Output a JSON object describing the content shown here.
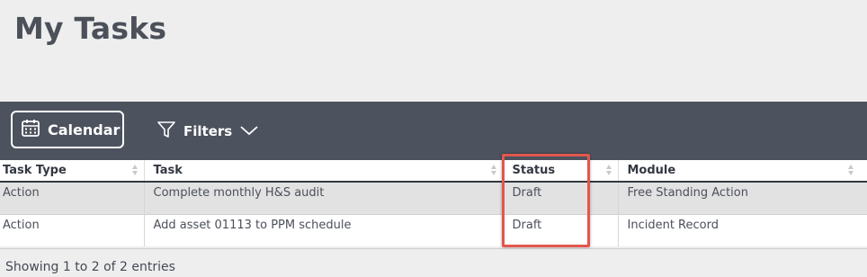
{
  "page": {
    "title": "My Tasks"
  },
  "toolbar": {
    "calendar_label": "Calendar",
    "filters_label": "Filters"
  },
  "table": {
    "columns": [
      "Task Type",
      "Task",
      "Status",
      "Module"
    ],
    "rows": [
      {
        "task_type": "Action",
        "task": "Complete monthly H&S audit",
        "status": "Draft",
        "module": "Free Standing Action"
      },
      {
        "task_type": "Action",
        "task": "Add asset 01113 to PPM schedule",
        "status": "Draft",
        "module": "Incident Record"
      }
    ]
  },
  "footer": {
    "info": "Showing 1 to 2 of 2 entries"
  },
  "colors": {
    "toolbar": "#4c525e",
    "highlight": "#e2574c",
    "page_bg": "#eeeeee"
  }
}
